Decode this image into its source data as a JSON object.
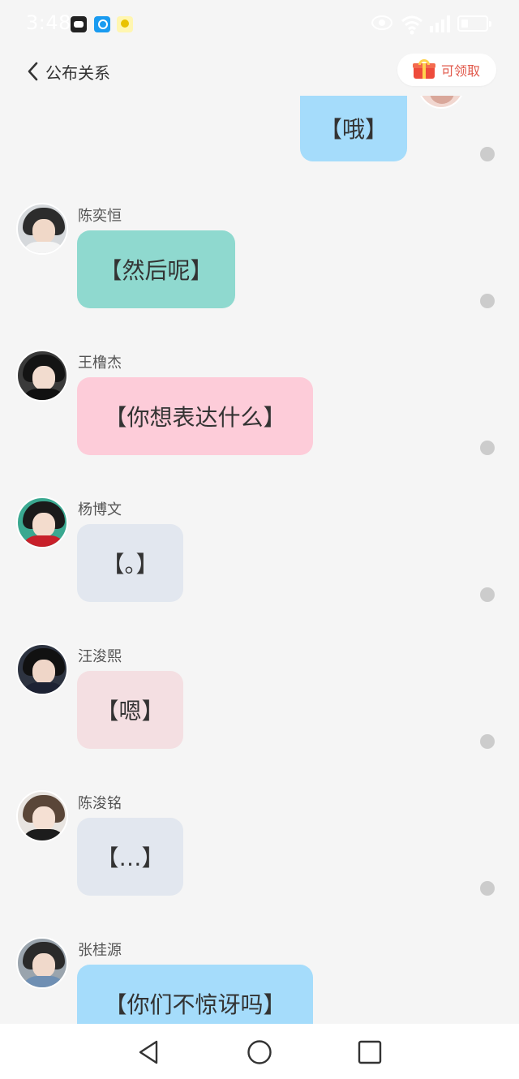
{
  "status_bar": {
    "time": "3:48",
    "icons": [
      "app-notification-icon",
      "search-app-icon",
      "game-app-icon",
      "eye-icon",
      "wifi-icon",
      "signal-icon",
      "battery-icon"
    ]
  },
  "header": {
    "back_icon": "chevron-left-icon",
    "title": "公布关系",
    "claim_button": {
      "icon": "gift-icon",
      "label": "可领取"
    }
  },
  "top_message": {
    "text": "【哦】",
    "color": "#a5dcfb",
    "side": "right"
  },
  "messages": [
    {
      "sender": "陈奕恒",
      "text": "【然后呢】",
      "color": "#8fd9cf"
    },
    {
      "sender": "王橹杰",
      "text": "【你想表达什么】",
      "color": "#fdccd9"
    },
    {
      "sender": "杨博文",
      "text": "【。】",
      "color": "#e2e7ef"
    },
    {
      "sender": "汪浚熙",
      "text": "【嗯】",
      "color": "#f4dfe2"
    },
    {
      "sender": "陈浚铭",
      "text": "【…】",
      "color": "#e2e7ef"
    },
    {
      "sender": "张桂源",
      "text": "【你们不惊讶吗】",
      "color": "#a5dcfb"
    }
  ],
  "nav_bar": {
    "icons": [
      "back-triangle-icon",
      "home-circle-icon",
      "recents-square-icon"
    ]
  }
}
